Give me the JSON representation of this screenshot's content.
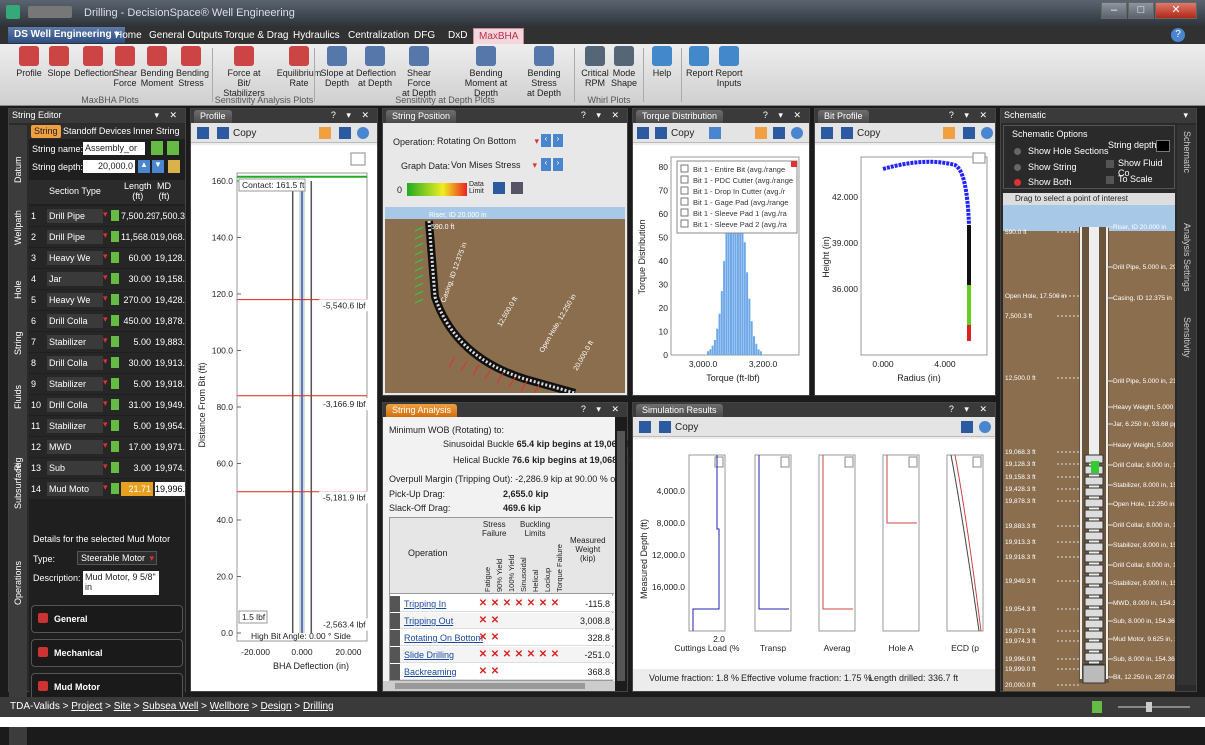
{
  "title": "Drilling - DecisionSpace® Well Engineering",
  "window_controls": {
    "min": "–",
    "max": "□",
    "close": "✕"
  },
  "app_menu": "DS Well Engineering ▾",
  "ribbon_tabs": [
    "Home",
    "General Outputs",
    "Torque & Drag",
    "Hydraulics",
    "Centralization",
    "DFG",
    "DxD",
    "MaxBHA"
  ],
  "ribbon": {
    "buttons": [
      {
        "l1": "Profile",
        "l2": "",
        "c": "#c44"
      },
      {
        "l1": "Slope",
        "l2": "",
        "c": "#c44"
      },
      {
        "l1": "Deflection",
        "l2": "",
        "c": "#c44"
      },
      {
        "l1": "Shear",
        "l2": "Force",
        "c": "#c44"
      },
      {
        "l1": "Bending",
        "l2": "Moment",
        "c": "#c44"
      },
      {
        "l1": "Bending",
        "l2": "Stress",
        "c": "#c44"
      },
      {
        "l1": "Force at Bit/",
        "l2": "Stabilizers",
        "c": "#c44"
      },
      {
        "l1": "Equilibrium",
        "l2": "Rate",
        "c": "#c44"
      },
      {
        "l1": "Slope at",
        "l2": "Depth",
        "c": "#57a"
      },
      {
        "l1": "Deflection",
        "l2": "at Depth",
        "c": "#57a"
      },
      {
        "l1": "Shear Force",
        "l2": "at Depth",
        "c": "#57a"
      },
      {
        "l1": "Bending",
        "l2": "Moment at Depth",
        "c": "#57a"
      },
      {
        "l1": "Bending Stress",
        "l2": "at Depth",
        "c": "#57a"
      },
      {
        "l1": "Critical",
        "l2": "RPM",
        "c": "#567"
      },
      {
        "l1": "Mode",
        "l2": "Shape",
        "c": "#567"
      },
      {
        "l1": "Help",
        "l2": "",
        "c": "#48c"
      },
      {
        "l1": "Report",
        "l2": "",
        "c": "#48c"
      },
      {
        "l1": "Report",
        "l2": "Inputs",
        "c": "#48c"
      }
    ],
    "groups": [
      "MaxBHA Plots",
      "Sensitivity Analysis Plots",
      "Sensitivity at Depth Plots",
      "Whirl Plots"
    ]
  },
  "string_editor": {
    "title": "String Editor",
    "tabs": [
      "String",
      "Standoff Devices",
      "Inner String"
    ],
    "name_label": "String name:",
    "name_value": "Assembly_or",
    "depth_label": "String depth:",
    "depth_value": "20,000.0",
    "columns": [
      "Section Type",
      "Length\n(ft)",
      "MD\n(ft)"
    ],
    "rows": [
      {
        "n": "1",
        "t": "Drill Pipe",
        "l": "7,500.29",
        "md": "7,500.3"
      },
      {
        "n": "2",
        "t": "Drill Pipe",
        "l": "11,568.00",
        "md": "19,068.3"
      },
      {
        "n": "3",
        "t": "Heavy We",
        "l": "60.00",
        "md": "19,128.3"
      },
      {
        "n": "4",
        "t": "Jar",
        "l": "30.00",
        "md": "19,158.3"
      },
      {
        "n": "5",
        "t": "Heavy We",
        "l": "270.00",
        "md": "19,428.3"
      },
      {
        "n": "6",
        "t": "Drill Colla",
        "l": "450.00",
        "md": "19,878.3"
      },
      {
        "n": "7",
        "t": "Stabilizer",
        "l": "5.00",
        "md": "19,883.3"
      },
      {
        "n": "8",
        "t": "Drill Colla",
        "l": "30.00",
        "md": "19,913.3"
      },
      {
        "n": "9",
        "t": "Stabilizer",
        "l": "5.00",
        "md": "19,918.3"
      },
      {
        "n": "10",
        "t": "Drill Colla",
        "l": "31.00",
        "md": "19,949.3"
      },
      {
        "n": "11",
        "t": "Stabilizer",
        "l": "5.00",
        "md": "19,954.3"
      },
      {
        "n": "12",
        "t": "MWD",
        "l": "17.00",
        "md": "19,971.3"
      },
      {
        "n": "13",
        "t": "Sub",
        "l": "3.00",
        "md": "19,974.3"
      },
      {
        "n": "14",
        "t": "Mud Moto",
        "l": "21.71",
        "md": "19,996.0"
      }
    ],
    "side_tabs": [
      "Datum",
      "Wellpath",
      "Hole",
      "String",
      "Fluids",
      "Rig",
      "Subsurface",
      "Operations"
    ],
    "details_title": "Details for the selected Mud Motor",
    "type_label": "Type:",
    "type_value": "Steerable Motor",
    "desc_label": "Description:",
    "desc_value": "Mud Motor, 9 5/8\" in",
    "sections": [
      "General",
      "Mechanical",
      "Mud Motor"
    ]
  },
  "profile": {
    "title": "Profile",
    "copy": "Copy",
    "contact": "Contact: 161.5 ft",
    "ylabel": "Distance From Bit (ft)",
    "xlabel": "BHA Deflection (in)",
    "yticks": [
      "160.0",
      "140.0",
      "120.0",
      "100.0",
      "80.0",
      "60.0",
      "40.0",
      "20.0",
      "0.0"
    ],
    "xticks": [
      "-20.000",
      "0.000",
      "20.000"
    ],
    "forces": [
      "-5,540.6 lbf",
      "-3,166.9 lbf",
      "-5,181.9 lbf",
      "-2,563.4 lbf"
    ],
    "bottom_left": "1.5 lbf",
    "bottom_note": "High  Bit Angle: 0.00 °  Side"
  },
  "string_position": {
    "title": "String Position",
    "op_label": "Operation:",
    "op_value": "Rotating On Bottom",
    "graph_label": "Graph Data:",
    "graph_value": "Von Mises Stress",
    "scale_min": "0",
    "scale_label": "Data\nLimit",
    "labels": [
      "Riser, ID 20.000 in",
      "590.0 ft",
      "Casing, ID 12.375 in",
      "12,500.0 ft",
      "Open Hole, 12.250 in",
      "20,000.0 ft"
    ]
  },
  "torque_dist": {
    "title": "Torque Distribution",
    "copy": "Copy",
    "ylabel": "Torque Distribution",
    "xlabel": "Torque (ft-lbf)",
    "yticks": [
      "80",
      "70",
      "60",
      "50",
      "40",
      "30",
      "20",
      "10",
      "0"
    ],
    "xticks": [
      "3,000.0",
      "3,200.0"
    ],
    "legend": [
      "Bit 1 - Entire Bit (avg./range",
      "Bit 1 - PDC Cutter (avg./range",
      "Bit 1 - Drop In Cutter (avg./r",
      "Bit 1 - Gage Pad (avg./range",
      "Bit 1 - Sleeve Pad 1 (avg./ra",
      "Bit 1 - Sleeve Pad 2 (avg./ra"
    ]
  },
  "bit_profile": {
    "title": "Bit Profile",
    "copy": "Copy",
    "ylabel": "Height (in)",
    "xlabel": "Radius (in)",
    "yticks": [
      "42.000",
      "39.000",
      "36.000"
    ],
    "xticks": [
      "0.000",
      "4.000"
    ]
  },
  "string_analysis": {
    "title": "String Analysis",
    "min_wob": "Minimum WOB (Rotating) to:",
    "sin_label": "Sinusoidal Buckle",
    "sin_val": "65.4 kip begins at 19,068.3 ft",
    "hel_label": "Helical Buckle",
    "hel_val": "76.6 kip begins at 19,068.3 ft",
    "overpull": "Overpull Margin (Tripping Out): -2,286.9 kip at 90.00 % of yie",
    "pickup_label": "Pick-Up Drag:",
    "pickup_val": "2,655.0 kip",
    "slackoff_label": "Slack-Off Drag:",
    "slackoff_val": "469.6 kip",
    "col_operation": "Operation",
    "grp_stress": "Stress\nFailure",
    "grp_buckling": "Buckling\nLimits",
    "vcols": [
      "Fatigue",
      "90% Yield",
      "100% Yield",
      "Sinusoidal",
      "Helical",
      "Lockup",
      "Torque Failure"
    ],
    "col_weight": "Measured\nWeight\n(kip)",
    "rows": [
      {
        "op": "Tripping In",
        "x": [
          1,
          1,
          1,
          1,
          1,
          1,
          1
        ],
        "w": "-115.8"
      },
      {
        "op": "Tripping Out",
        "x": [
          1,
          1,
          0,
          0,
          0,
          0,
          0
        ],
        "w": "3,008.8"
      },
      {
        "op": "Rotating On Bottom",
        "x": [
          1,
          1,
          0,
          0,
          0,
          0,
          0
        ],
        "w": "328.8"
      },
      {
        "op": "Slide Drilling",
        "x": [
          1,
          1,
          1,
          1,
          1,
          1,
          1
        ],
        "w": "-251.0"
      },
      {
        "op": "Backreaming",
        "x": [
          1,
          1,
          0,
          0,
          0,
          0,
          0
        ],
        "w": "368.8"
      }
    ]
  },
  "sim_results": {
    "title": "Simulation Results",
    "copy": "Copy",
    "ylabel": "Measured Depth (ft)",
    "yticks": [
      "4,000.0",
      "8,000.0",
      "12,000.0",
      "16,000.0"
    ],
    "x_first": "2.0",
    "subplots": [
      "Cuttings Load (%",
      "Transp",
      "Averag",
      "Hole A",
      "ECD (p"
    ],
    "footer": [
      "Volume fraction: 1.8 %",
      "Effective volume fraction: 1.75 %",
      "Length drilled: 336.7 ft"
    ]
  },
  "schematic": {
    "title": "Schematic",
    "options_title": "Schematic Options",
    "options": [
      "Show Hole Sections",
      "Show String",
      "Show Both"
    ],
    "depth_label": "String depth:",
    "fluid": "Show Fluid Co",
    "toscale": "To Scale",
    "drag_hint": "Drag to select a point of interest",
    "side_tabs": [
      "Schematic",
      "Analysis Settings",
      "Sensitivity"
    ],
    "left_labels": [
      {
        "t": "590.0 ft",
        "y": 233
      },
      {
        "t": "Open Hole, 17.500\nin",
        "y": 297
      },
      {
        "t": "7,500.3 ft",
        "y": 317
      },
      {
        "t": "12,500.0 ft",
        "y": 379
      },
      {
        "t": "19,068.3 ft",
        "y": 453
      },
      {
        "t": "19,128.3 ft",
        "y": 465
      },
      {
        "t": "19,158.3 ft",
        "y": 478
      },
      {
        "t": "19,428.3 ft",
        "y": 490
      },
      {
        "t": "19,878.3 ft",
        "y": 502
      },
      {
        "t": "19,883.3 ft",
        "y": 527
      },
      {
        "t": "19,913.3 ft",
        "y": 543
      },
      {
        "t": "19,918.3 ft",
        "y": 558
      },
      {
        "t": "19,949.3 ft",
        "y": 582
      },
      {
        "t": "19,954.3 ft",
        "y": 610
      },
      {
        "t": "19,971.3 ft",
        "y": 632
      },
      {
        "t": "19,974.3 ft",
        "y": 642
      },
      {
        "t": "19,996.0 ft",
        "y": 660
      },
      {
        "t": "19,999.0 ft",
        "y": 670
      },
      {
        "t": "20,000.0 ft",
        "y": 686
      }
    ],
    "right_labels": [
      {
        "t": "Riser, ID 20.000 in",
        "y": 228
      },
      {
        "t": "Drill Pipe, 5.000 in,\n29.35 ppf",
        "y": 268
      },
      {
        "t": "Casing, ID 12.375\nin",
        "y": 299
      },
      {
        "t": "Drill Pipe, 5.000 in,\n21.92 ppf",
        "y": 382
      },
      {
        "t": "Heavy Weight,\n5.000 in, 49.70 ppf",
        "y": 408
      },
      {
        "t": "Jar, 6.250 in, 93.68\nppf",
        "y": 425
      },
      {
        "t": "Heavy Weight,\n5.000 in, 49.70 ppf",
        "y": 446
      },
      {
        "t": "Drill Collar, 8.000\nin, 154.33 ppf",
        "y": 466
      },
      {
        "t": "Stabilizer, 8.000 in,\n154.36 ppf",
        "y": 486
      },
      {
        "t": "Open Hole, 12.250\nin",
        "y": 505
      },
      {
        "t": "Drill Collar, 8.000\nin, 154.33 ppf",
        "y": 526
      },
      {
        "t": "Stabilizer, 8.000 in,\n154.36 ppf",
        "y": 546
      },
      {
        "t": "Drill Collar, 8.000\nin, 154.33 ppf",
        "y": 566
      },
      {
        "t": "Stabilizer, 8.000 in,\n154.36 ppf",
        "y": 584
      },
      {
        "t": "MWD, 8.000 in,\n154.36 ppf",
        "y": 604
      },
      {
        "t": "Sub, 8.000 in,\n154.36 ppf",
        "y": 622
      },
      {
        "t": "Mud Motor, 9.625\nin, 165.00 ppf",
        "y": 640
      },
      {
        "t": "Sub, 8.000 in,\n154.36 ppf",
        "y": 660
      },
      {
        "t": "Bit, 12.250 in,\n287.00 ppf",
        "y": 678
      }
    ]
  },
  "breadcrumb": [
    "TDA-Valids",
    "Project",
    "Site",
    "Subsea Well",
    "Wellbore",
    "Design",
    "Drilling"
  ],
  "colors": {
    "accent": "#c0304a",
    "orange": "#f0a040",
    "ground": "#8a6e4e"
  }
}
